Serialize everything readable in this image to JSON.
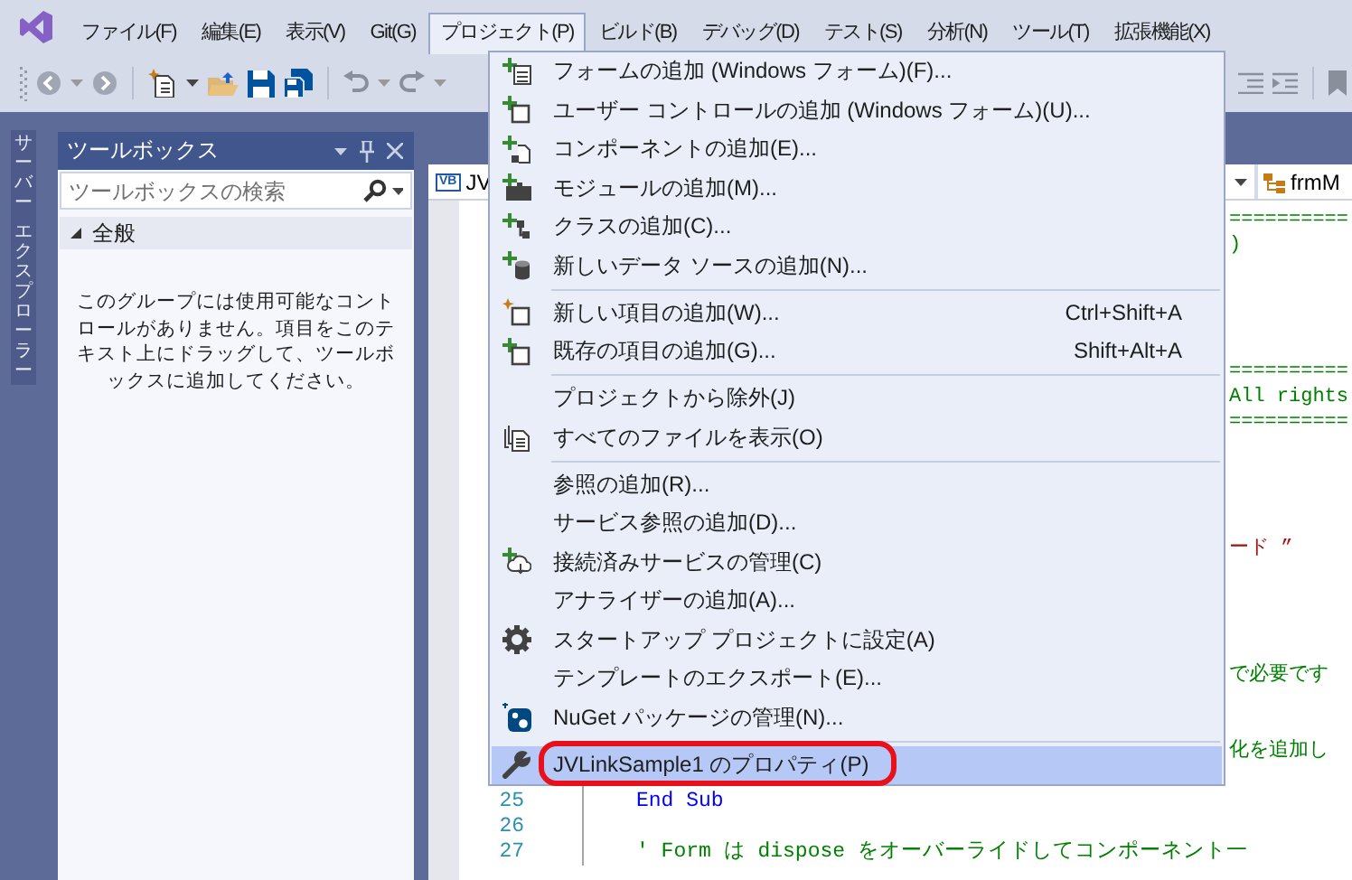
{
  "menu_bar": {
    "items": [
      {
        "label": "ファイル(F)",
        "selected": false
      },
      {
        "label": "編集(E)",
        "selected": false
      },
      {
        "label": "表示(V)",
        "selected": false
      },
      {
        "label": "Git(G)",
        "selected": false
      },
      {
        "label": "プロジェクト(P)",
        "selected": true
      },
      {
        "label": "ビルド(B)",
        "selected": false
      },
      {
        "label": "デバッグ(D)",
        "selected": false
      },
      {
        "label": "テスト(S)",
        "selected": false
      },
      {
        "label": "分析(N)",
        "selected": false
      },
      {
        "label": "ツール(T)",
        "selected": false
      },
      {
        "label": "拡張機能(X)",
        "selected": false
      }
    ]
  },
  "side_tab": {
    "label_lines": [
      "サーバー",
      "エクスプローラー"
    ]
  },
  "toolbox": {
    "title": "ツールボックス",
    "search": {
      "placeholder": "ツールボックスの検索"
    },
    "group": {
      "label": "全般",
      "expanded": true
    },
    "message": "このグループには使用可能なコントロールがありません。項目をこのテキスト上にドラッグして、ツールボックスに追加してください。"
  },
  "editor": {
    "file_type": "VB",
    "file_dropdown": "JV",
    "member_dropdown": "frmM",
    "lines": [
      {
        "kind": "comment",
        "text": "=========="
      },
      {
        "kind": "comment",
        "text": ")"
      },
      {
        "kind": "blank"
      },
      {
        "kind": "blank"
      },
      {
        "kind": "blank"
      },
      {
        "kind": "blank"
      },
      {
        "kind": "comment",
        "text": "=========="
      },
      {
        "kind": "comment",
        "text": "All rights"
      },
      {
        "kind": "comment",
        "text": "=========="
      },
      {
        "kind": "blank"
      },
      {
        "kind": "blank"
      },
      {
        "kind": "blank"
      },
      {
        "kind": "blank"
      },
      {
        "kind": "string",
        "text": "ード ”"
      },
      {
        "kind": "blank"
      },
      {
        "kind": "blank"
      },
      {
        "kind": "blank"
      },
      {
        "kind": "blank"
      },
      {
        "kind": "comment",
        "text": "で必要です"
      },
      {
        "kind": "blank"
      },
      {
        "kind": "blank"
      },
      {
        "kind": "comment",
        "text": "化を追加し"
      },
      {
        "kind": "blank"
      },
      {
        "kind": "keyword",
        "number": "25",
        "text": "End Sub"
      },
      {
        "kind": "blank",
        "number": "26"
      },
      {
        "kind": "comment",
        "number": "27",
        "text": "' Form は dispose をオーバーライドしてコンポーネント一"
      }
    ]
  },
  "project_menu": {
    "items": [
      {
        "kind": "item",
        "label": "フォームの追加 (Windows フォーム)(F)...",
        "selected": false,
        "annotated": false
      },
      {
        "kind": "item",
        "label": "ユーザー コントロールの追加 (Windows フォーム)(U)...",
        "selected": false,
        "annotated": false
      },
      {
        "kind": "item",
        "label": "コンポーネントの追加(E)...",
        "selected": false,
        "annotated": false
      },
      {
        "kind": "item",
        "label": "モジュールの追加(M)...",
        "selected": false,
        "annotated": false
      },
      {
        "kind": "item",
        "label": "クラスの追加(C)...",
        "selected": false,
        "annotated": false
      },
      {
        "kind": "item",
        "label": "新しいデータ ソースの追加(N)...",
        "selected": false,
        "annotated": false
      },
      {
        "kind": "separator"
      },
      {
        "kind": "item",
        "label": "新しい項目の追加(W)...",
        "shortcut": "Ctrl+Shift+A",
        "selected": false,
        "annotated": false
      },
      {
        "kind": "item",
        "label": "既存の項目の追加(G)...",
        "shortcut": "Shift+Alt+A",
        "selected": false,
        "annotated": false
      },
      {
        "kind": "separator"
      },
      {
        "kind": "item",
        "label": "プロジェクトから除外(J)",
        "selected": false,
        "annotated": false
      },
      {
        "kind": "item",
        "label": "すべてのファイルを表示(O)",
        "selected": false,
        "annotated": false
      },
      {
        "kind": "separator"
      },
      {
        "kind": "item",
        "label": "参照の追加(R)...",
        "selected": false,
        "annotated": false
      },
      {
        "kind": "item",
        "label": "サービス参照の追加(D)...",
        "selected": false,
        "annotated": false
      },
      {
        "kind": "item",
        "label": "接続済みサービスの管理(C)",
        "selected": false,
        "annotated": false
      },
      {
        "kind": "item",
        "label": "アナライザーの追加(A)...",
        "selected": false,
        "annotated": false
      },
      {
        "kind": "item",
        "label": "スタートアップ プロジェクトに設定(A)",
        "selected": false,
        "annotated": false
      },
      {
        "kind": "item",
        "label": "テンプレートのエクスポート(E)...",
        "selected": false,
        "annotated": false
      },
      {
        "kind": "item",
        "label": "NuGet パッケージの管理(N)...",
        "selected": false,
        "annotated": false
      },
      {
        "kind": "separator"
      },
      {
        "kind": "item",
        "label": "JVLinkSample1 のプロパティ(P)",
        "selected": true,
        "annotated": true
      }
    ]
  }
}
